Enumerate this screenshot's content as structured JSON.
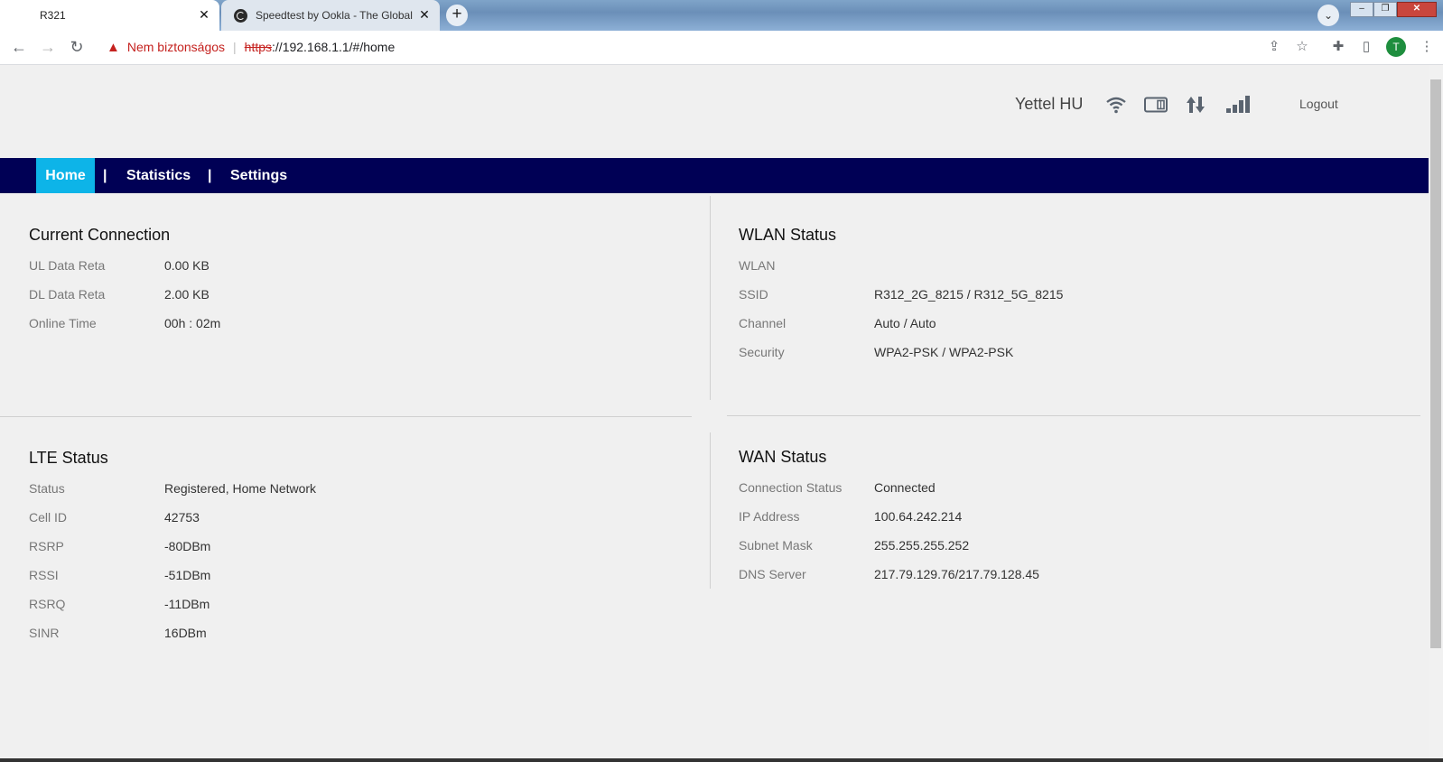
{
  "browser": {
    "tabs": [
      {
        "title": "R321"
      },
      {
        "title": "Speedtest by Ookla - The Global"
      }
    ],
    "address": {
      "security_label": "Nem biztonságos",
      "scheme": "https",
      "rest": "://192.168.1.1/#/home"
    },
    "profile_initial": "T"
  },
  "header": {
    "carrier": "Yettel HU",
    "logout": "Logout"
  },
  "nav": {
    "items": [
      {
        "label": "Home"
      },
      {
        "label": "Statistics"
      },
      {
        "label": "Settings"
      }
    ],
    "separator": "|"
  },
  "sections": {
    "current_connection": {
      "title": "Current Connection",
      "rows": [
        {
          "label": "UL Data Reta",
          "value": "0.00 KB"
        },
        {
          "label": "DL Data Reta",
          "value": "2.00 KB"
        },
        {
          "label": "Online Time",
          "value": "00h : 02m"
        }
      ]
    },
    "wlan_status": {
      "title": "WLAN Status",
      "rows": [
        {
          "label": "WLAN",
          "value": ""
        },
        {
          "label": "SSID",
          "value": "R312_2G_8215 / R312_5G_8215"
        },
        {
          "label": "Channel",
          "value": "Auto / Auto"
        },
        {
          "label": "Security",
          "value": "WPA2-PSK / WPA2-PSK"
        }
      ]
    },
    "lte_status": {
      "title": "LTE Status",
      "rows": [
        {
          "label": "Status",
          "value": "Registered, Home Network"
        },
        {
          "label": "Cell ID",
          "value": "42753"
        },
        {
          "label": "RSRP",
          "value": "-80DBm"
        },
        {
          "label": "RSSI",
          "value": "-51DBm"
        },
        {
          "label": "RSRQ",
          "value": "-11DBm"
        },
        {
          "label": "SINR",
          "value": "16DBm"
        }
      ]
    },
    "wan_status": {
      "title": "WAN Status",
      "rows": [
        {
          "label": "Connection Status",
          "value": "Connected"
        },
        {
          "label": "IP Address",
          "value": "100.64.242.214"
        },
        {
          "label": "Subnet Mask",
          "value": "255.255.255.252"
        },
        {
          "label": "DNS Server",
          "value": "217.79.129.76/217.79.128.45"
        }
      ]
    }
  },
  "colors": {
    "nav_background": "#000055",
    "nav_active": "#0db4e8",
    "insecure": "#c5221f"
  }
}
